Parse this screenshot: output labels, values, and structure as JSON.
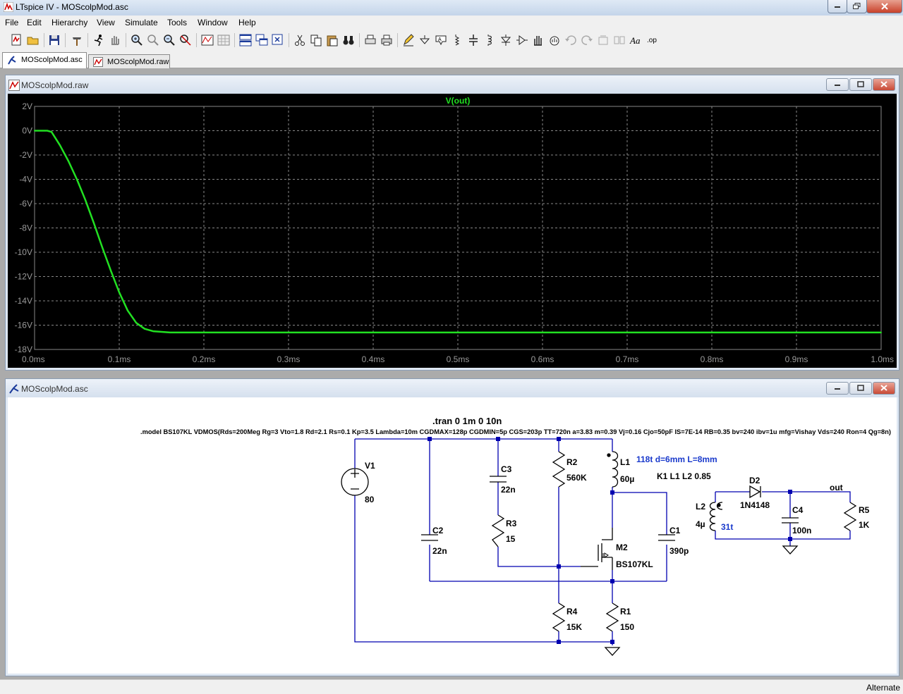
{
  "window": {
    "title": "LTspice IV - MOScolpMod.asc"
  },
  "menu": [
    "File",
    "Edit",
    "Hierarchy",
    "View",
    "Simulate",
    "Tools",
    "Window",
    "Help"
  ],
  "tabs": [
    {
      "label": "MOScolpMod.asc",
      "active": true
    },
    {
      "label": "MOScolpMod.raw",
      "active": false
    }
  ],
  "waveform_window": {
    "title": "MOScolpMod.raw"
  },
  "schematic_window": {
    "title": "MOScolpMod.asc"
  },
  "colors": {
    "trace": "#22e022",
    "grid": "#888888",
    "wire": "#0000b0",
    "plot_bg": "#000000"
  },
  "chart_data": {
    "type": "line",
    "title": "V(out)",
    "xlabel": "",
    "ylabel": "",
    "x_ticks": [
      "0.0ms",
      "0.1ms",
      "0.2ms",
      "0.3ms",
      "0.4ms",
      "0.5ms",
      "0.6ms",
      "0.7ms",
      "0.8ms",
      "0.9ms",
      "1.0ms"
    ],
    "y_ticks": [
      "2V",
      "0V",
      "-2V",
      "-4V",
      "-6V",
      "-8V",
      "-10V",
      "-12V",
      "-14V",
      "-16V",
      "-18V"
    ],
    "xlim": [
      0,
      1.0
    ],
    "ylim": [
      -18,
      2
    ],
    "x_unit": "ms",
    "series": [
      {
        "name": "V(out)",
        "x": [
          0,
          0.015,
          0.02,
          0.03,
          0.04,
          0.05,
          0.06,
          0.07,
          0.08,
          0.09,
          0.1,
          0.11,
          0.12,
          0.13,
          0.14,
          0.15,
          0.16,
          0.2,
          0.3,
          0.4,
          0.5,
          0.6,
          0.7,
          0.8,
          0.9,
          1.0
        ],
        "y": [
          0,
          0,
          -0.1,
          -1.2,
          -2.5,
          -4.0,
          -5.7,
          -7.6,
          -9.6,
          -11.5,
          -13.3,
          -14.8,
          -15.8,
          -16.3,
          -16.5,
          -16.55,
          -16.6,
          -16.6,
          -16.6,
          -16.6,
          -16.6,
          -16.6,
          -16.6,
          -16.6,
          -16.6,
          -16.6
        ]
      }
    ]
  },
  "schematic": {
    "directive_tran": ".tran 0 1m 0 10n",
    "directive_model": ".model BS107KL VDMOS(Rds=200Meg Rg=3 Vto=1.8 Rd=2.1 Rs=0.1 Kp=3.5 Lambda=10m CGDMAX=128p CGDMIN=5p CGS=203p TT=720n a=3.83 m=0.39 Vj=0.16 Cjo=50pF IS=7E-14 RB=0.35 bv=240 ibv=1u mfg=Vishay Vds=240 Ron=4 Qg=8n)",
    "coil_note": "118t d=6mm L=8mm",
    "coupling": "K1 L1 L2 0.85",
    "turns_note": "31t",
    "net_out": "out",
    "components": {
      "V1": {
        "name": "V1",
        "value": "80"
      },
      "C2": {
        "name": "C2",
        "value": "22n"
      },
      "C3": {
        "name": "C3",
        "value": "22n"
      },
      "R3": {
        "name": "R3",
        "value": "15"
      },
      "R2": {
        "name": "R2",
        "value": "560K"
      },
      "L1": {
        "name": "L1",
        "value": "60µ"
      },
      "M2": {
        "name": "M2",
        "value": "BS107KL"
      },
      "C1": {
        "name": "C1",
        "value": "390p"
      },
      "R4": {
        "name": "R4",
        "value": "15K"
      },
      "R1": {
        "name": "R1",
        "value": "150"
      },
      "L2": {
        "name": "L2",
        "value": "4µ"
      },
      "D2": {
        "name": "D2",
        "value": "1N4148"
      },
      "C4": {
        "name": "C4",
        "value": "100n"
      },
      "R5": {
        "name": "R5",
        "value": "1K"
      }
    }
  },
  "status": {
    "text": "Alternate"
  }
}
